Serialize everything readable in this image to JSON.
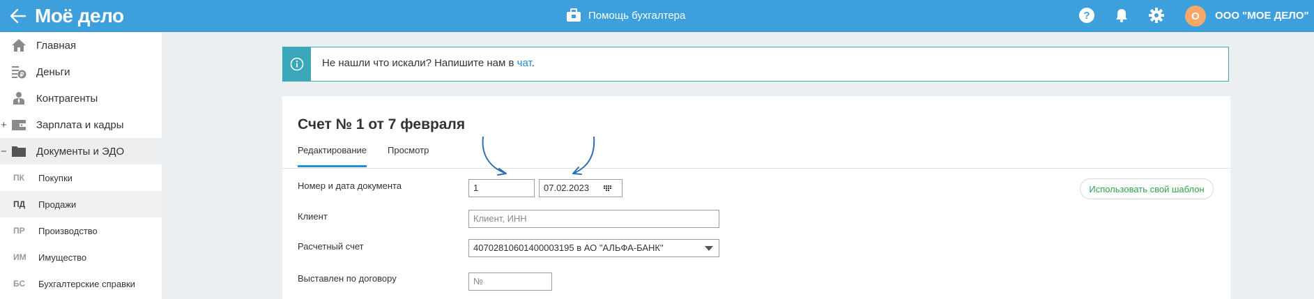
{
  "topbar": {
    "logo": "Моё дело",
    "helper_label": "Помощь бухгалтера",
    "avatar_letter": "О",
    "org_name": "ООО \"МОЕ ДЕЛО\"",
    "icons": [
      "help-icon",
      "bell-icon",
      "gear-icon"
    ]
  },
  "sidebar": {
    "items": [
      {
        "label": "Главная",
        "icon": "home-icon"
      },
      {
        "label": "Деньги",
        "icon": "money-icon"
      },
      {
        "label": "Контрагенты",
        "icon": "contractors-icon"
      },
      {
        "label": "Зарплата и кадры",
        "icon": "wallet-icon",
        "toggle": "+"
      },
      {
        "label": "Документы и ЭДО",
        "icon": "folder-icon",
        "toggle": "−"
      }
    ],
    "sub_items": [
      {
        "abbr": "ПК",
        "label": "Покупки"
      },
      {
        "abbr": "ПД",
        "label": "Продажи"
      },
      {
        "abbr": "ПР",
        "label": "Производство"
      },
      {
        "abbr": "ИМ",
        "label": "Имущество"
      },
      {
        "abbr": "БС",
        "label": "Бухгалтерские справки"
      }
    ]
  },
  "banner": {
    "text": "Не нашли что искали? Напишите нам в ",
    "link": "чат",
    "suffix": "."
  },
  "document": {
    "title": "Счет № 1 от 7 февраля",
    "tabs": [
      "Редактирование",
      "Просмотр"
    ],
    "active_tab": "Редактирование",
    "template_button": "Использовать свой шаблон",
    "fields": {
      "number_date_label": "Номер и дата документа",
      "number_value": "1",
      "date_value": "07.02.2023",
      "client_label": "Клиент",
      "client_placeholder": "Клиент, ИНН",
      "account_label": "Расчетный счет",
      "account_value": "40702810601400003195 в АО \"АЛЬФА-БАНК\"",
      "contract_label": "Выставлен по договору",
      "contract_placeholder": "№"
    }
  },
  "colors": {
    "topbar": "#3da0dc",
    "accent": "#1f8fd6",
    "banner_border": "#3aa6ba",
    "template_button_text": "#2ea24d",
    "avatar": "#f5a86a",
    "annotation_arrow": "#2e6fb0"
  }
}
